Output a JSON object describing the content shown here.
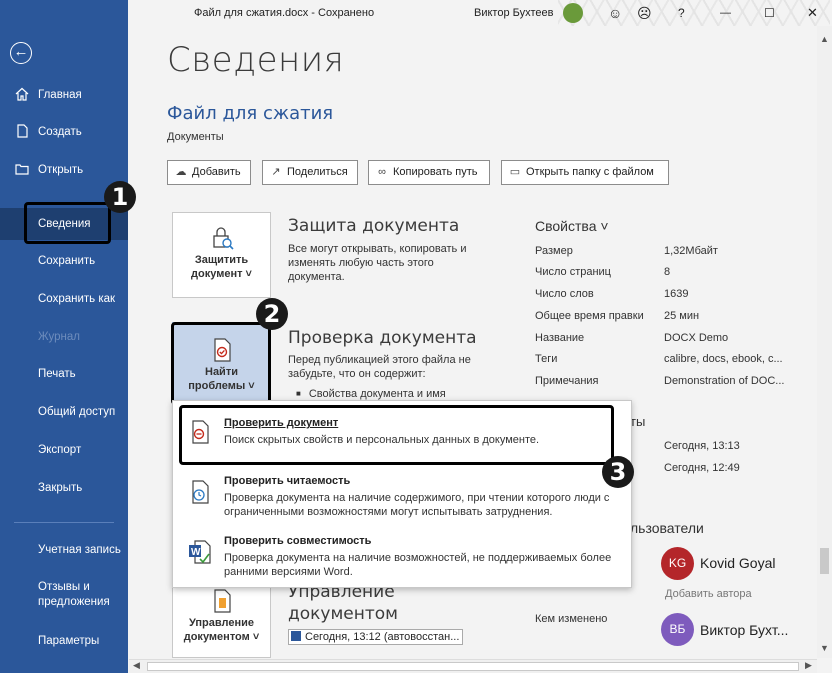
{
  "titlebar": {
    "doc_title": "Файл для сжатия.docx  -  Сохранено",
    "user_name": "Виктор Бухтеев",
    "help": "?",
    "minimize": "—",
    "maximize": "☐",
    "close": "✕"
  },
  "sidebar": {
    "back_icon": "←",
    "items": [
      {
        "label": "Главная",
        "icon": "home-icon"
      },
      {
        "label": "Создать",
        "icon": "new-doc-icon"
      },
      {
        "label": "Открыть",
        "icon": "folder-icon"
      },
      {
        "label": "Сведения"
      },
      {
        "label": "Сохранить"
      },
      {
        "label": "Сохранить как"
      },
      {
        "label": "Журнал"
      },
      {
        "label": "Печать"
      },
      {
        "label": "Общий доступ"
      },
      {
        "label": "Экспорт"
      },
      {
        "label": "Закрыть"
      },
      {
        "label": "Учетная запись"
      },
      {
        "label": "Отзывы и предложения"
      },
      {
        "label": "Параметры"
      }
    ]
  },
  "page": {
    "title": "Сведения",
    "file_name": "Файл для сжатия",
    "file_location": "Документы"
  },
  "toolbar": {
    "add": "Добавить",
    "share": "Поделиться",
    "copy_path": "Копировать путь",
    "open_folder": "Открыть папку с файлом"
  },
  "protect": {
    "tile_label": "Защитить документ ˅",
    "title": "Защита документа",
    "desc": "Все могут открывать, копировать и изменять любую часть этого документа."
  },
  "inspect": {
    "tile_label": "Найти проблемы ˅",
    "title": "Проверка документа",
    "desc": "Перед публикацией этого файла не забудьте, что он содержит:",
    "bullet": "Свойства документа и имя"
  },
  "dropdown": {
    "items": [
      {
        "title": "Проверить документ",
        "desc": "Поиск скрытых свойств и персональных данных в документе."
      },
      {
        "title": "Проверить читаемость",
        "desc": "Проверка документа на наличие содержимого, при чтении которого люди с ограниченными возможностями могут испытывать затруднения."
      },
      {
        "title": "Проверить совместимость",
        "desc": "Проверка документа на наличие возможностей, не поддерживаемых более ранними версиями Word."
      }
    ]
  },
  "manage": {
    "tile_label": "Управление документом ˅",
    "title": "Управление документом",
    "version": "Сегодня, 13:12 (автовосстан..."
  },
  "properties": {
    "header": "Свойства ˅",
    "rows": [
      {
        "key": "Размер",
        "value": "1,32Мбайт"
      },
      {
        "key": "Число страниц",
        "value": "8"
      },
      {
        "key": "Число слов",
        "value": "1639"
      },
      {
        "key": "Общее время правки",
        "value": "25 мин"
      },
      {
        "key": "Название",
        "value": "DOCX Demo"
      },
      {
        "key": "Теги",
        "value": "calibre, docs, ebook, c..."
      },
      {
        "key": "Примечания",
        "value": "Demonstration of DOC..."
      }
    ],
    "dates_header_tail": "ты",
    "date1": "Сегодня, 13:13",
    "date2": "Сегодня, 12:49",
    "people_header_tail": "льзователи",
    "author": {
      "initials": "KG",
      "name": "Kovid Goyal",
      "color": "#b4262a"
    },
    "add_author": "Добавить автора",
    "modified_by_label": "Кем изменено",
    "modifier": {
      "initials": "ВБ",
      "name": "Виктор Бухт...",
      "color": "#7e5bbd"
    }
  },
  "badges": [
    "1",
    "2",
    "3"
  ]
}
